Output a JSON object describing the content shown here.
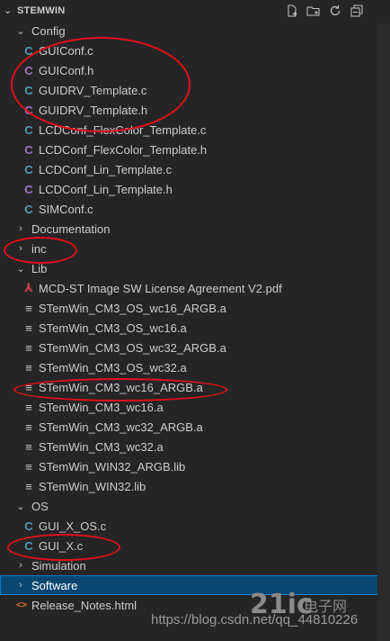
{
  "explorer": {
    "title": "STEMWIN",
    "actions": [
      {
        "name": "new-file-icon"
      },
      {
        "name": "new-folder-icon"
      },
      {
        "name": "refresh-icon"
      },
      {
        "name": "collapse-all-icon"
      }
    ]
  },
  "tree": [
    {
      "label": "Config",
      "kind": "folder-open",
      "indent": 1
    },
    {
      "label": "GUIConf.c",
      "kind": "c",
      "indent": 2
    },
    {
      "label": "GUIConf.h",
      "kind": "h",
      "indent": 2
    },
    {
      "label": "GUIDRV_Template.c",
      "kind": "c",
      "indent": 2
    },
    {
      "label": "GUIDRV_Template.h",
      "kind": "h",
      "indent": 2
    },
    {
      "label": "LCDConf_FlexColor_Template.c",
      "kind": "c",
      "indent": 2
    },
    {
      "label": "LCDConf_FlexColor_Template.h",
      "kind": "h",
      "indent": 2
    },
    {
      "label": "LCDConf_Lin_Template.c",
      "kind": "c",
      "indent": 2
    },
    {
      "label": "LCDConf_Lin_Template.h",
      "kind": "h",
      "indent": 2
    },
    {
      "label": "SIMConf.c",
      "kind": "c",
      "indent": 2
    },
    {
      "label": "Documentation",
      "kind": "folder-closed",
      "indent": 1
    },
    {
      "label": "inc",
      "kind": "folder-closed",
      "indent": 1
    },
    {
      "label": "Lib",
      "kind": "folder-open",
      "indent": 1
    },
    {
      "label": "MCD-ST Image SW License Agreement V2.pdf",
      "kind": "pdf",
      "indent": 2
    },
    {
      "label": "STemWin_CM3_OS_wc16_ARGB.a",
      "kind": "lib",
      "indent": 2
    },
    {
      "label": "STemWin_CM3_OS_wc16.a",
      "kind": "lib",
      "indent": 2
    },
    {
      "label": "STemWin_CM3_OS_wc32_ARGB.a",
      "kind": "lib",
      "indent": 2
    },
    {
      "label": "STemWin_CM3_OS_wc32.a",
      "kind": "lib",
      "indent": 2
    },
    {
      "label": "STemWin_CM3_wc16_ARGB.a",
      "kind": "lib",
      "indent": 2
    },
    {
      "label": "STemWin_CM3_wc16.a",
      "kind": "lib",
      "indent": 2
    },
    {
      "label": "STemWin_CM3_wc32_ARGB.a",
      "kind": "lib",
      "indent": 2
    },
    {
      "label": "STemWin_CM3_wc32.a",
      "kind": "lib",
      "indent": 2
    },
    {
      "label": "STemWin_WIN32_ARGB.lib",
      "kind": "lib",
      "indent": 2
    },
    {
      "label": "STemWin_WIN32.lib",
      "kind": "lib",
      "indent": 2
    },
    {
      "label": "OS",
      "kind": "folder-open",
      "indent": 1
    },
    {
      "label": "GUI_X_OS.c",
      "kind": "c",
      "indent": 2
    },
    {
      "label": "GUI_X.c",
      "kind": "c",
      "indent": 2
    },
    {
      "label": "Simulation",
      "kind": "folder-closed",
      "indent": 1
    },
    {
      "label": "Software",
      "kind": "folder-closed",
      "indent": 1,
      "selected": true
    },
    {
      "label": "Release_Notes.html",
      "kind": "html",
      "indent": 1
    }
  ],
  "icons": {
    "c": {
      "glyph": "C",
      "color": "#519aba",
      "name": "c-file-icon"
    },
    "h": {
      "glyph": "C",
      "color": "#a074c4",
      "name": "h-file-icon"
    },
    "pdf": {
      "glyph": "⅄",
      "color": "#cc3e44",
      "name": "pdf-file-icon"
    },
    "lib": {
      "glyph": "≡",
      "color": "#cccccc",
      "name": "binary-file-icon"
    },
    "html": {
      "glyph": "<>",
      "color": "#e37933",
      "name": "html-file-icon"
    }
  },
  "annotations": {
    "highlight_color": "#e0101a",
    "highlighted_items": [
      "GUIConf.c",
      "GUIConf.h",
      "GUIDRV_Template.c",
      "GUIDRV_Template.h",
      "inc",
      "STemWin_CM3_wc16_ARGB.a",
      "GUI_X.c"
    ]
  },
  "watermark": {
    "url": "https://blog.csdn.net/qq_44810226",
    "logo_text": "21ic",
    "logo_sub": "电子网"
  }
}
